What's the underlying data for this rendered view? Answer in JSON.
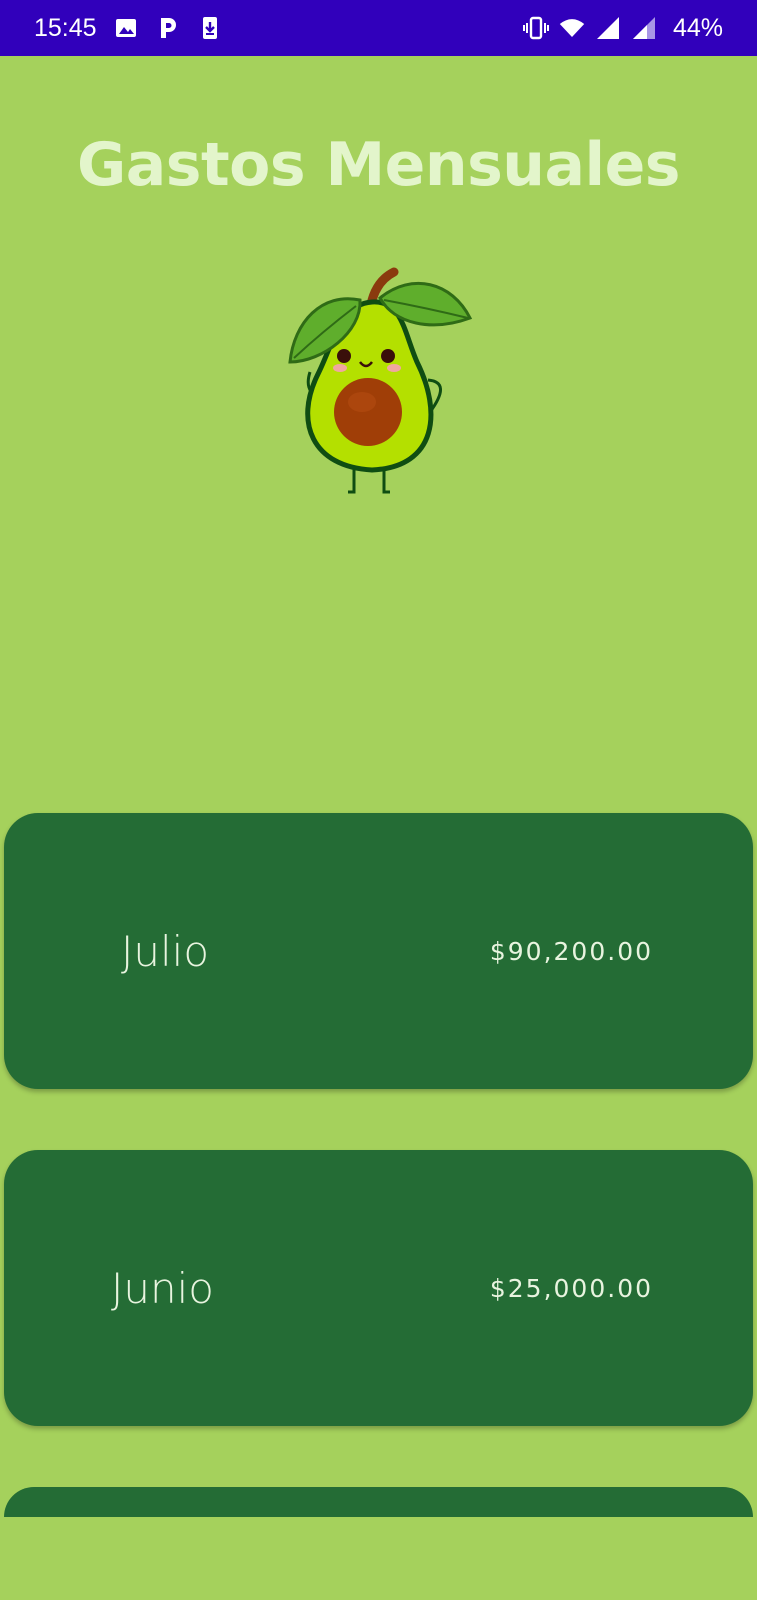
{
  "status_bar": {
    "time": "15:45",
    "left_icons": [
      "image-icon",
      "parking-icon",
      "download-icon"
    ],
    "right_icons": [
      "vibrate-icon",
      "wifi-icon",
      "signal-icon",
      "signal-icon"
    ],
    "battery": "44%"
  },
  "page": {
    "title": "Gastos Mensuales"
  },
  "expenses": [
    {
      "month": "Julio",
      "amount": "$90,200.00"
    },
    {
      "month": "Junio",
      "amount": "$25,000.00"
    }
  ],
  "colors": {
    "background": "#a5d15c",
    "status_bar": "#3100bb",
    "card": "#246c35",
    "title_text": "#e3f5cb",
    "card_text": "#e8f4df"
  }
}
